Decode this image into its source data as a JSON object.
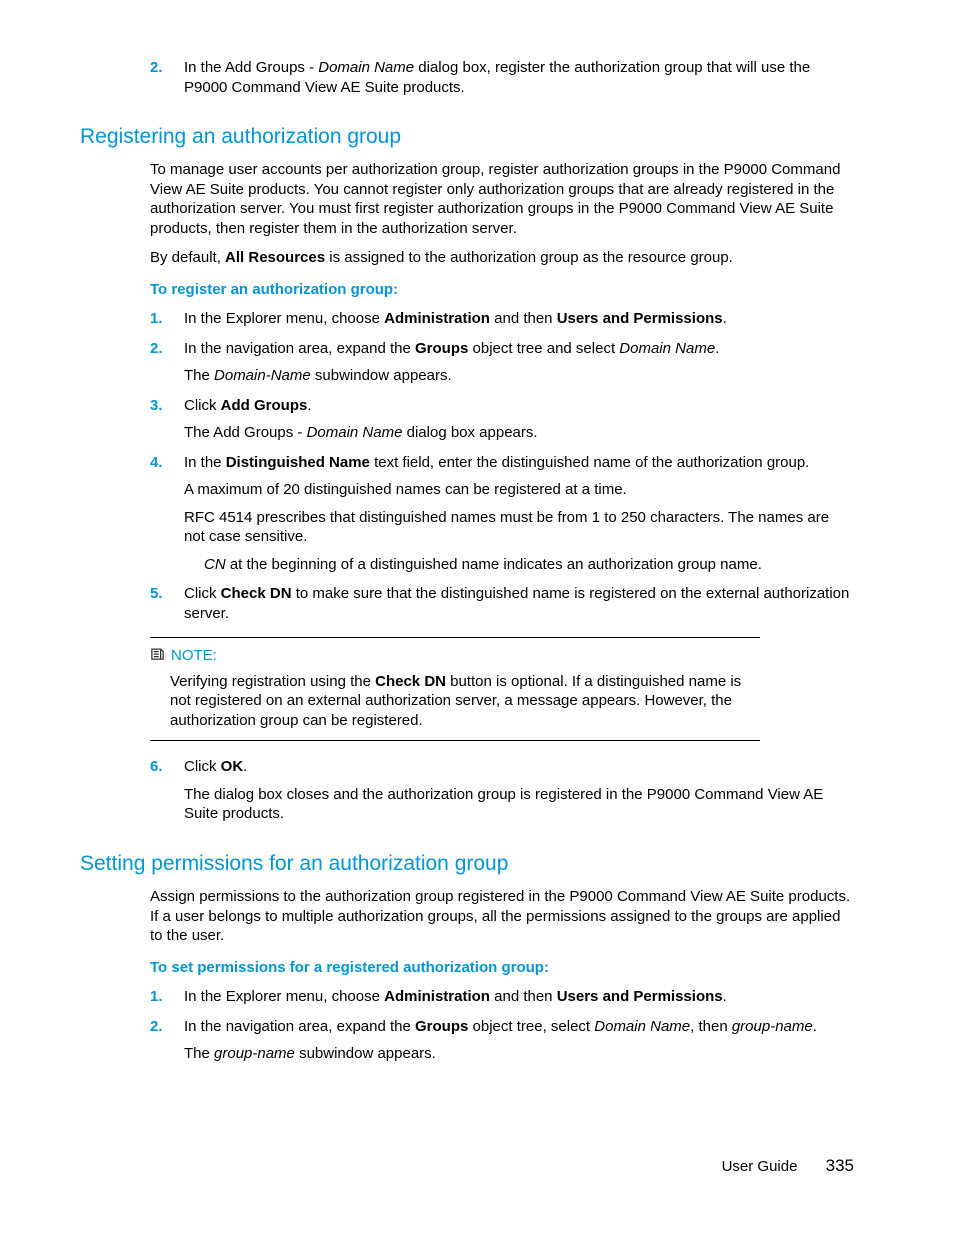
{
  "introStep": {
    "num": "2.",
    "text_a": "In the Add Groups - ",
    "text_b": " dialog box, register the authorization group that will use the P9000 Command View AE Suite products.",
    "placeholder": "Domain Name"
  },
  "section1": {
    "title": "Registering an authorization group",
    "para1": "To manage user accounts per authorization group, register authorization groups in the P9000 Command View AE Suite products. You cannot register only authorization groups that are already registered in the authorization server. You must first register authorization groups in the P9000 Command View AE Suite products, then register them in the authorization server.",
    "para2_a": "By default, ",
    "para2_bold": "All Resources",
    "para2_b": " is assigned to the authorization group as the resource group.",
    "subhead": "To register an authorization group:",
    "steps": {
      "s1_a": "In the Explorer menu, choose ",
      "s1_b1": "Administration",
      "s1_mid": " and then ",
      "s1_b2": "Users and Permissions",
      "s1_end": ".",
      "s2_a": "In the navigation area, expand the ",
      "s2_bold": "Groups",
      "s2_b": " object tree and select ",
      "s2_ph": "Domain Name",
      "s2_end": ".",
      "s2_sub_a": "The ",
      "s2_sub_ph": "Domain-Name",
      "s2_sub_b": " subwindow appears.",
      "s3_a": "Click ",
      "s3_bold": "Add Groups",
      "s3_end": ".",
      "s3_sub_a": "The Add Groups - ",
      "s3_sub_ph": "Domain Name",
      "s3_sub_b": " dialog box appears.",
      "s4_a": "In the ",
      "s4_bold": "Distinguished Name",
      "s4_b": " text field, enter the distinguished name of the authorization group.",
      "s4_sub1": "A maximum of 20 distinguished names can be registered at a time.",
      "s4_sub2": "RFC 4514 prescribes that distinguished names must be from 1 to 250 characters. The names are not case sensitive.",
      "s4_sub3_ph": "CN",
      "s4_sub3": " at the beginning of a distinguished name indicates an authorization group name.",
      "s5_a": "Click ",
      "s5_bold": "Check DN",
      "s5_b": " to make sure that the distinguished name is registered on the external authorization server.",
      "s6_a": "Click ",
      "s6_bold": "OK",
      "s6_end": ".",
      "s6_sub": "The dialog box closes and the authorization group is registered in the P9000 Command View AE Suite products."
    },
    "note": {
      "label": "NOTE:",
      "body_a": "Verifying registration using the ",
      "body_bold": "Check DN",
      "body_b": " button is optional. If a distinguished name is not registered on an external authorization server, a message appears. However, the authorization group can be registered."
    }
  },
  "section2": {
    "title": "Setting permissions for an authorization group",
    "para1": "Assign permissions to the authorization group registered in the P9000 Command View AE Suite products. If a user belongs to multiple authorization groups, all the permissions assigned to the groups are applied to the user.",
    "subhead": "To set permissions for a registered authorization group:",
    "steps": {
      "s1_a": "In the Explorer menu, choose ",
      "s1_b1": "Administration",
      "s1_mid": " and then ",
      "s1_b2": "Users and Permissions",
      "s1_end": ".",
      "s2_a": "In the navigation area, expand the ",
      "s2_bold": "Groups",
      "s2_b": " object tree, select ",
      "s2_ph1": "Domain Name",
      "s2_mid": ", then ",
      "s2_ph2": "group-name",
      "s2_end": ".",
      "s2_sub_a": "The ",
      "s2_sub_ph": "group-name",
      "s2_sub_b": " subwindow appears."
    }
  },
  "footer": {
    "label": "User Guide",
    "page": "335"
  }
}
